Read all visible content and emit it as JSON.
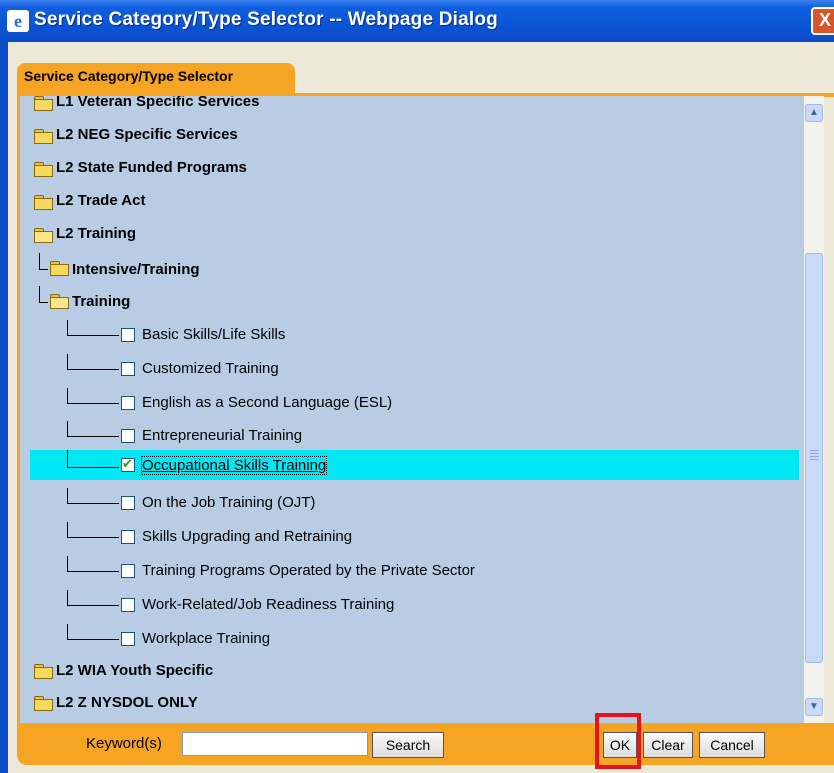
{
  "window": {
    "title": "Service Category/Type Selector -- Webpage Dialog",
    "close_glyph": "X"
  },
  "tab": {
    "label": "Service Category/Type Selector"
  },
  "tree": {
    "folders_top": [
      {
        "label": "L1 Veteran Specific Services"
      },
      {
        "label": "L2 NEG Specific Services"
      },
      {
        "label": "L2 State Funded Programs"
      },
      {
        "label": "L2 Trade Act"
      },
      {
        "label": "L2 Training"
      }
    ],
    "subfolders": [
      {
        "label": "Intensive/Training"
      },
      {
        "label": "Training"
      }
    ],
    "items": [
      {
        "label": "Basic Skills/Life Skills",
        "checked": false
      },
      {
        "label": "Customized Training",
        "checked": false
      },
      {
        "label": "English as a Second Language (ESL)",
        "checked": false
      },
      {
        "label": "Entrepreneurial Training",
        "checked": false
      },
      {
        "label": "Occupational Skills Training",
        "checked": true
      },
      {
        "label": "On the Job Training (OJT)",
        "checked": false
      },
      {
        "label": "Skills Upgrading and Retraining",
        "checked": false
      },
      {
        "label": "Training Programs Operated by the Private Sector",
        "checked": false
      },
      {
        "label": "Work-Related/Job Readiness Training",
        "checked": false
      },
      {
        "label": "Workplace Training",
        "checked": false
      }
    ],
    "folders_bottom": [
      {
        "label": "L2 WIA Youth Specific"
      },
      {
        "label": "L2 Z NYSDOL ONLY"
      }
    ]
  },
  "footer": {
    "keyword_label": "Keyword(s)",
    "keyword_value": "",
    "search_label": "Search",
    "ok_label": "OK",
    "clear_label": "Clear",
    "cancel_label": "Cancel"
  },
  "colors": {
    "accent": "#f5a424",
    "panel": "#b8cde3",
    "selected_row": "#00e8f4",
    "highlight_box": "#e8121c"
  },
  "icons": {
    "title": "ie-icon",
    "folder": "folder-icon",
    "open_folder": "folder-open-icon"
  }
}
